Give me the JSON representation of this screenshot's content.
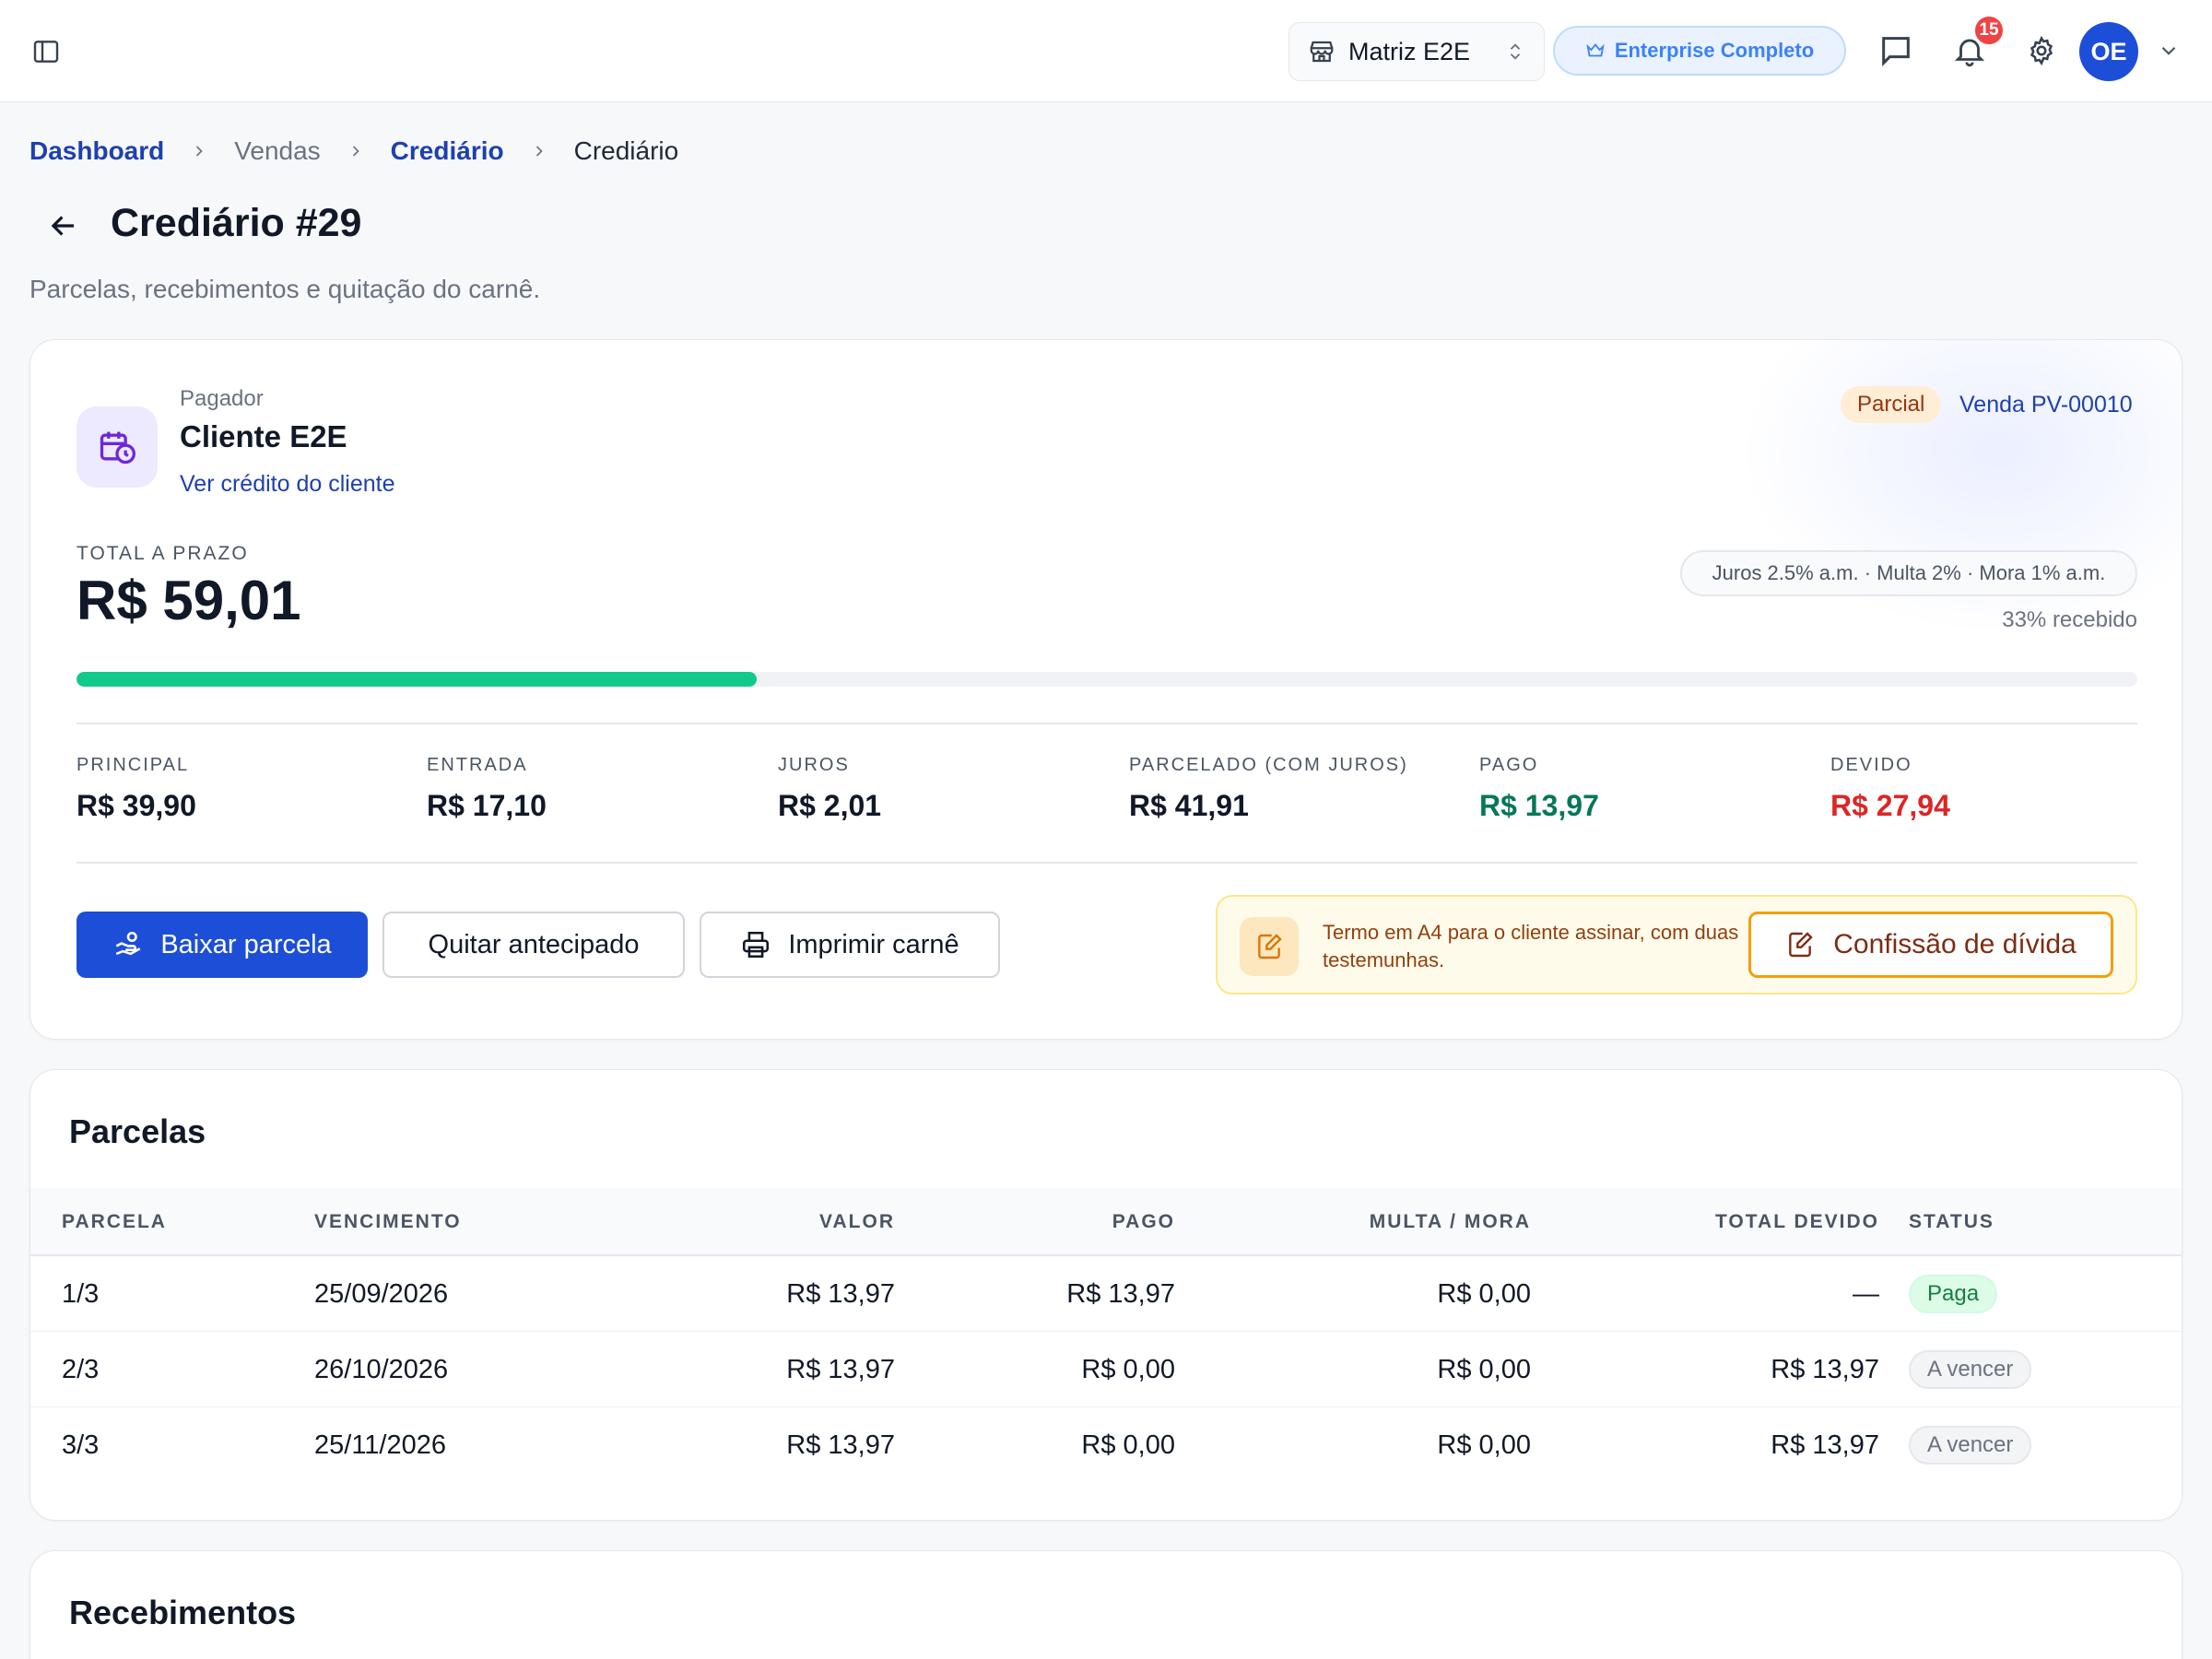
{
  "header": {
    "store_name": "Matriz E2E",
    "plan_label": "Enterprise Completo",
    "notification_count": "15",
    "avatar_initials": "OE",
    "colors": {
      "brand": "#1d4ed8",
      "plan": "#3b82f6",
      "notification": "#ef4444"
    }
  },
  "breadcrumb": [
    {
      "label": "Dashboard"
    },
    {
      "label": "Vendas"
    },
    {
      "label": "Crediário"
    },
    {
      "label": "Crediário"
    }
  ],
  "page": {
    "title": "Crediário #29",
    "subtitle": "Parcelas, recebimentos e quitação do carnê."
  },
  "summary": {
    "payer_label": "Pagador",
    "payer_name": "Cliente E2E",
    "payer_link": "Ver crédito do cliente",
    "status_badge": "Parcial",
    "sale_link": "Venda PV-00010",
    "total_label": "TOTAL A PRAZO",
    "total_value": "R$ 59,01",
    "rates": "Juros 2.5% a.m. · Multa 2% · Mora 1% a.m.",
    "received_text": "33% recebido",
    "progress_fraction": 0.33,
    "stats": [
      {
        "label": "PRINCIPAL",
        "value": "R$ 39,90",
        "tone": "default"
      },
      {
        "label": "ENTRADA",
        "value": "R$ 17,10",
        "tone": "default"
      },
      {
        "label": "JUROS",
        "value": "R$ 2,01",
        "tone": "default"
      },
      {
        "label": "PARCELADO (COM JUROS)",
        "value": "R$ 41,91",
        "tone": "default"
      },
      {
        "label": "PAGO",
        "value": "R$ 13,97",
        "tone": "green"
      },
      {
        "label": "DEVIDO",
        "value": "R$ 27,94",
        "tone": "red"
      }
    ],
    "actions": {
      "pay_installment": "Baixar parcela",
      "early_payoff": "Quitar antecipado",
      "print_booklet": "Imprimir carnê"
    },
    "debt": {
      "description": "Termo em A4 para o cliente assinar, com duas testemunhas.",
      "button": "Confissão de dívida"
    }
  },
  "installments": {
    "title": "Parcelas",
    "columns": {
      "parcela": "PARCELA",
      "vencimento": "VENCIMENTO",
      "valor": "VALOR",
      "pago": "PAGO",
      "multa": "MULTA / MORA",
      "total": "TOTAL DEVIDO",
      "status": "STATUS"
    },
    "rows": [
      {
        "parcela": "1/3",
        "vencimento": "25/09/2026",
        "valor": "R$ 13,97",
        "pago": "R$ 13,97",
        "multa": "R$ 0,00",
        "total": "—",
        "status": "Paga",
        "status_type": "paid"
      },
      {
        "parcela": "2/3",
        "vencimento": "26/10/2026",
        "valor": "R$ 13,97",
        "pago": "R$ 0,00",
        "multa": "R$ 0,00",
        "total": "R$ 13,97",
        "status": "A vencer",
        "status_type": "due"
      },
      {
        "parcela": "3/3",
        "vencimento": "25/11/2026",
        "valor": "R$ 13,97",
        "pago": "R$ 0,00",
        "multa": "R$ 0,00",
        "total": "R$ 13,97",
        "status": "A vencer",
        "status_type": "due"
      }
    ]
  },
  "receipts": {
    "title": "Recebimentos"
  },
  "icons": [
    "sidebar-toggle-icon",
    "store-icon",
    "chevron-updown-icon",
    "crown-icon",
    "chat-icon",
    "bell-icon",
    "gear-icon",
    "chevron-down-icon",
    "arrow-left-icon",
    "calendar-clock-icon",
    "hand-coins-icon",
    "printer-icon",
    "document-edit-icon"
  ]
}
